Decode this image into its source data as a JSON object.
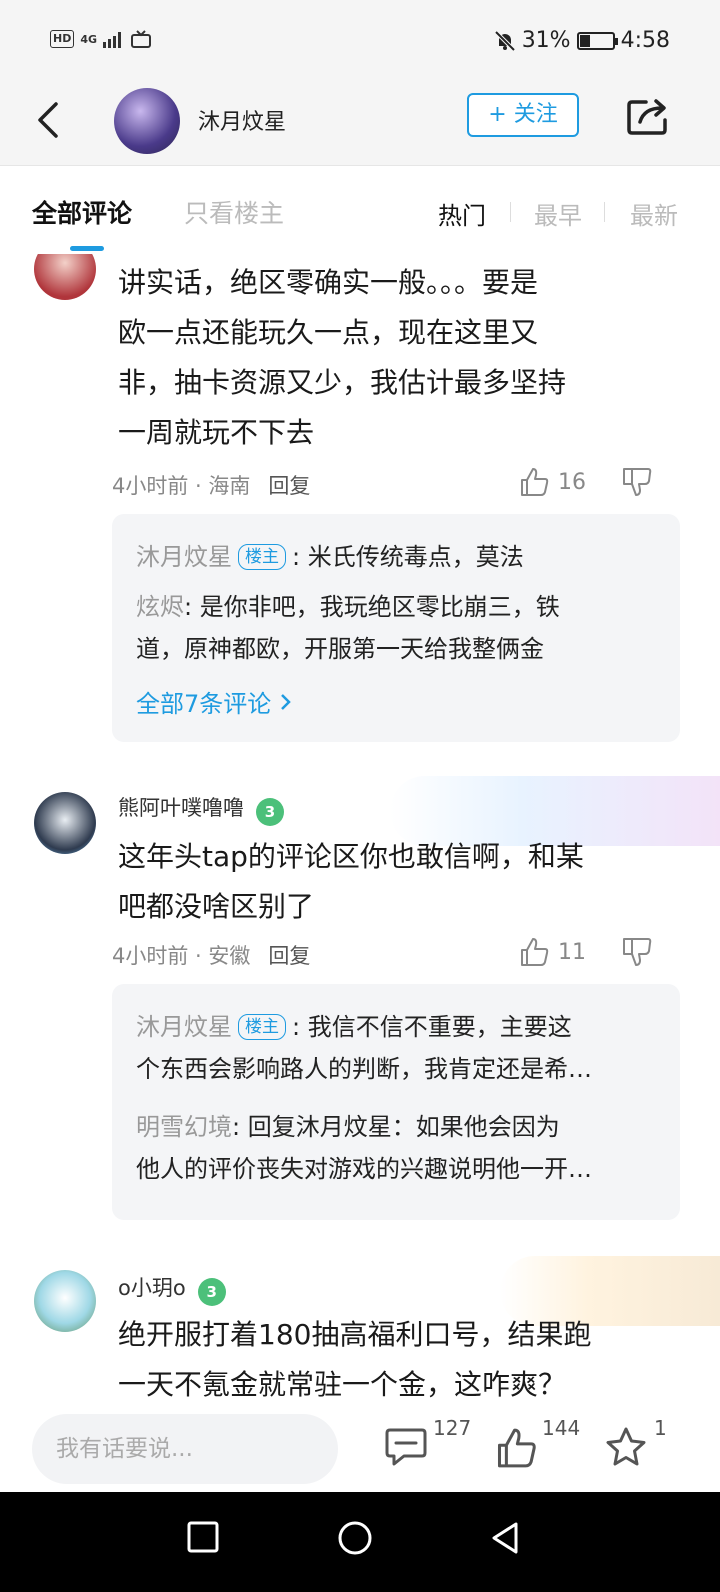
{
  "status_bar": {
    "hd": "HD",
    "net": "4G",
    "battery": "31%",
    "battery_level": 0.31,
    "time": "4:58"
  },
  "header": {
    "author": "沐月炆星",
    "follow_label": "+ 关注"
  },
  "tabs": {
    "all": "全部评论",
    "host_only": "只看楼主",
    "hot": "热门",
    "earliest": "最早",
    "newest": "最新"
  },
  "comments": [
    {
      "lines": [
        "讲实话，绝区零确实一般。。。要是",
        "欧一点还能玩久一点，现在这里又",
        "非，抽卡资源又少，我估计最多坚持",
        "一周就玩不下去"
      ],
      "time_loc": "4小时前 · 海南",
      "reply_label": "回复",
      "likes": "16",
      "replies": [
        {
          "name": "沐月炆星",
          "is_host": true,
          "text": "米氏传统毒点，莫法"
        },
        {
          "name": "炫烬",
          "line1": "是你非吧，我玩绝区零比崩三，铁",
          "line2": "道，原神都欧，开服第一天给我整俩金"
        }
      ],
      "more": "全部7条评论"
    },
    {
      "user": "熊阿叶噗噜噜",
      "level": "3",
      "lines": [
        "这年头tap的评论区你也敢信啊，和某",
        "吧都没啥区别了"
      ],
      "time_loc": "4小时前 · 安徽",
      "reply_label": "回复",
      "likes": "11",
      "replies": [
        {
          "name": "沐月炆星",
          "is_host": true,
          "line1": "我信不信不重要，主要这",
          "line2": "个东西会影响路人的判断，我肯定还是希…"
        },
        {
          "name": "明雪幻境",
          "line1": "回复沐月炆星：如果他会因为",
          "line2": "他人的评价丧失对游戏的兴趣说明他一开…"
        }
      ]
    },
    {
      "user": "o小玥o",
      "level": "3",
      "lines": [
        "绝开服打着180抽高福利口号，结果跑",
        "一天不氪金就常驻一个金，这咋爽？"
      ]
    }
  ],
  "host_tag": "楼主",
  "bottom_bar": {
    "placeholder": "我有话要说...",
    "comments": "127",
    "likes": "144",
    "favorites": "1"
  },
  "colors": {
    "accent": "#1e9be0",
    "level_badge": "#4cc07a"
  }
}
